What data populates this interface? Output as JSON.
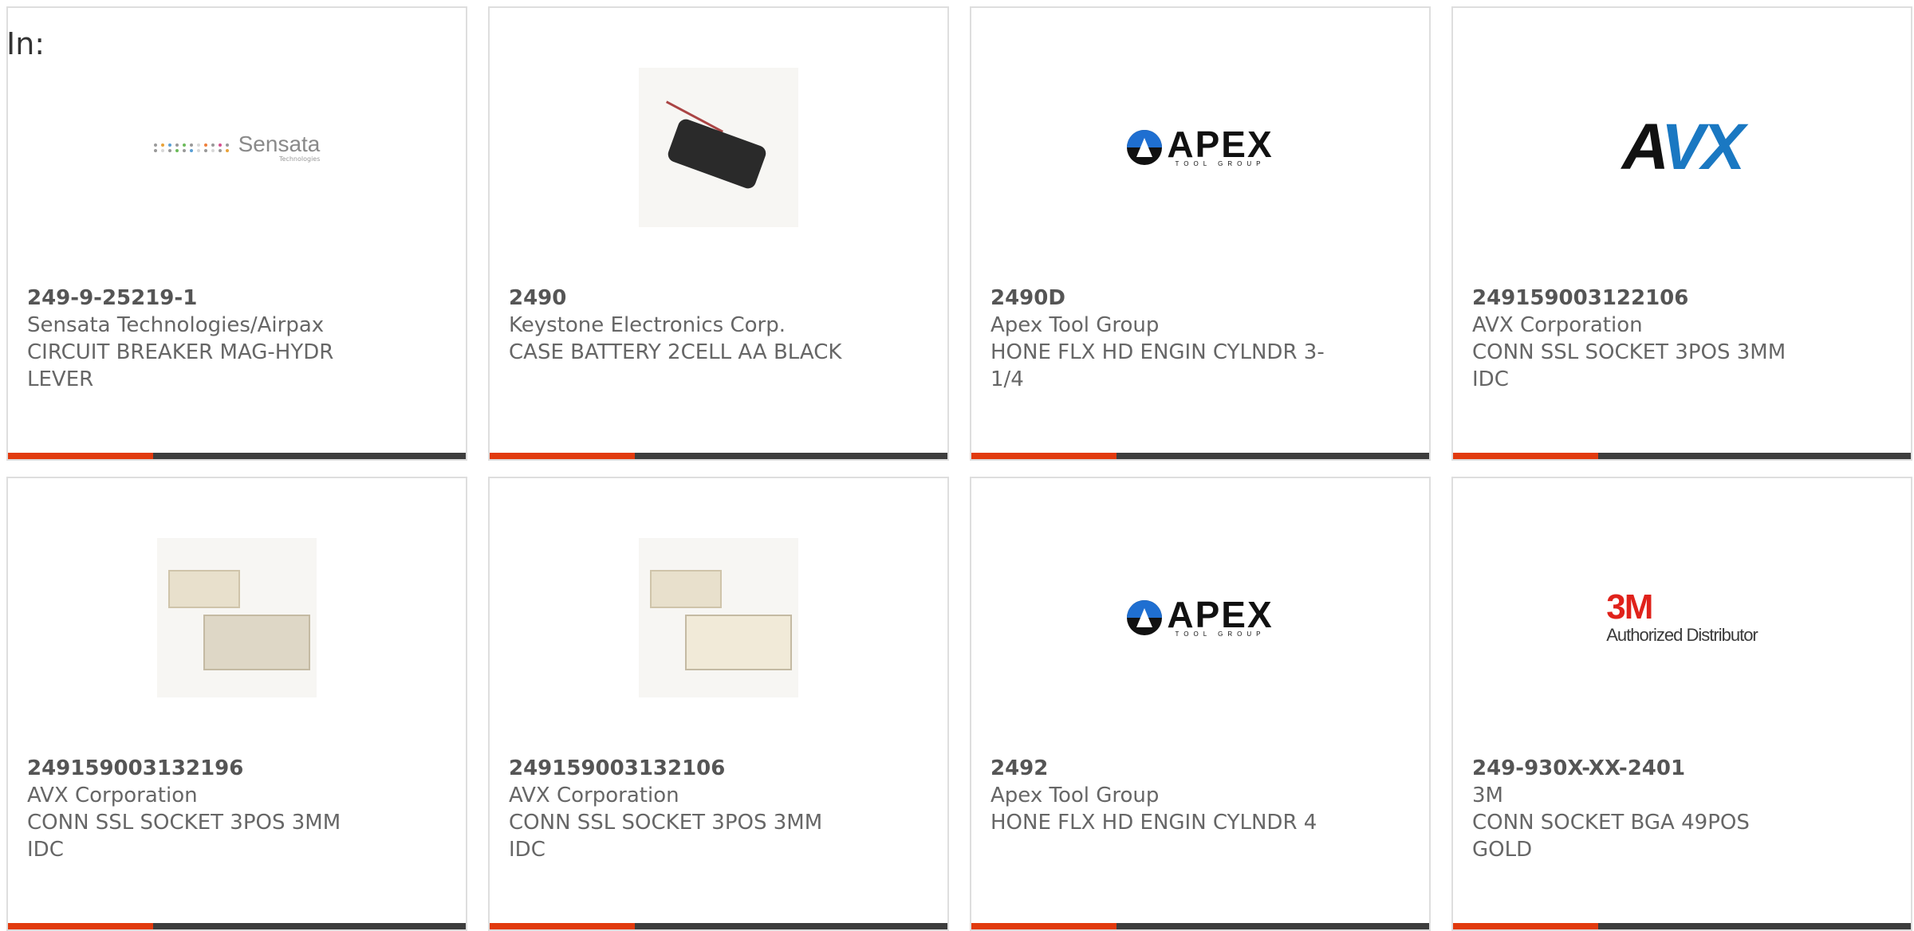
{
  "header": {
    "in_label": "In:"
  },
  "colors": {
    "accent": "#e13a0e",
    "bar": "#3d3d3d",
    "border": "#dedede",
    "text": "#666666"
  },
  "cards": [
    {
      "part_number": "249-9-25219-1",
      "manufacturer": "Sensata Technologies/Airpax",
      "description": "CIRCUIT BREAKER MAG-HYDR LEVER",
      "image": "sensata-logo",
      "logo_text": "Sensata",
      "logo_subtext": "Technologies"
    },
    {
      "part_number": "2490",
      "manufacturer": "Keystone Electronics Corp.",
      "description": "CASE BATTERY 2CELL AA BLACK",
      "image": "battery-holder-photo"
    },
    {
      "part_number": "2490D",
      "manufacturer": "Apex Tool Group",
      "description": "HONE FLX HD ENGIN CYLNDR 3-1/4",
      "image": "apex-logo",
      "logo_text": "APEX",
      "logo_subtext": "TOOL GROUP"
    },
    {
      "part_number": "249159003122106",
      "manufacturer": "AVX Corporation",
      "description": "CONN SSL SOCKET 3POS 3MM IDC",
      "image": "avx-logo",
      "logo_text": "AVX"
    },
    {
      "part_number": "249159003132196",
      "manufacturer": "AVX Corporation",
      "description": "CONN SSL SOCKET 3POS 3MM IDC",
      "image": "connector-photo"
    },
    {
      "part_number": "249159003132106",
      "manufacturer": "AVX Corporation",
      "description": "CONN SSL SOCKET 3POS 3MM IDC",
      "image": "connector-photo"
    },
    {
      "part_number": "2492",
      "manufacturer": "Apex Tool Group",
      "description": "HONE FLX HD ENGIN CYLNDR 4",
      "image": "apex-logo",
      "logo_text": "APEX",
      "logo_subtext": "TOOL GROUP"
    },
    {
      "part_number": "249-930X-XX-2401",
      "manufacturer": "3M",
      "description": "CONN SOCKET BGA 49POS GOLD",
      "image": "3m-logo",
      "logo_text": "3M",
      "logo_subtext": "Authorized Distributor"
    }
  ]
}
